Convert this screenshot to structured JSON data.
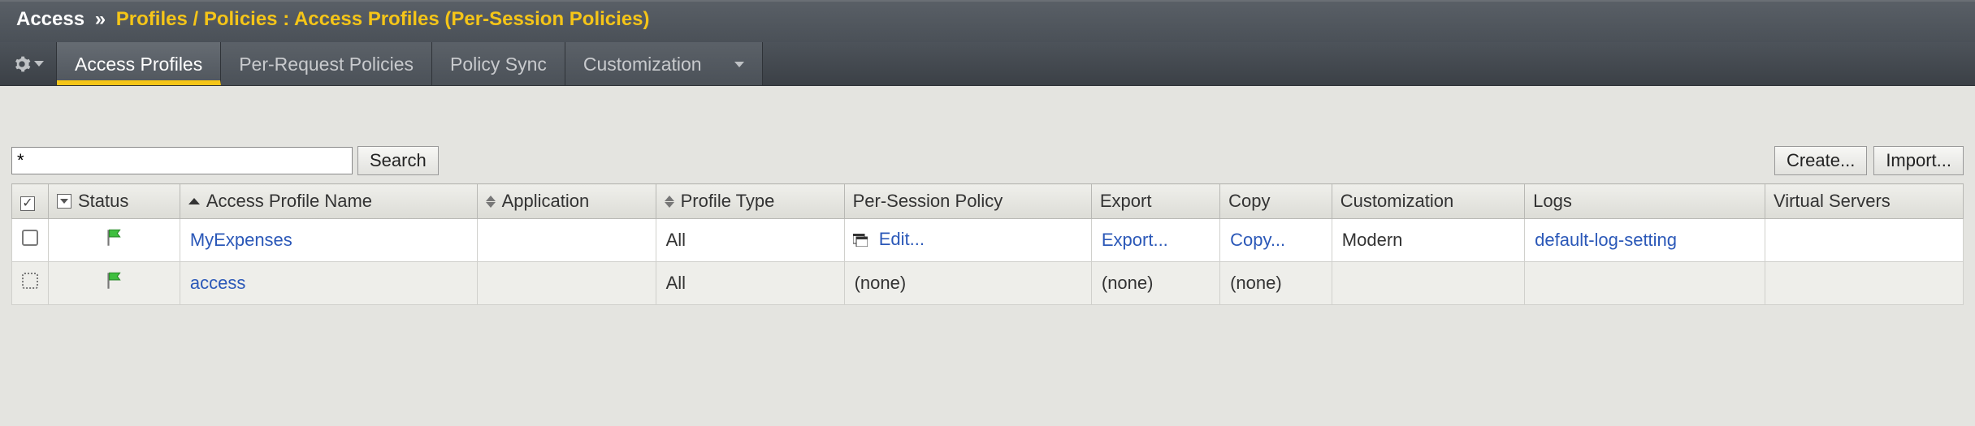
{
  "breadcrumb": {
    "section": "Access",
    "separator": "»",
    "path": "Profiles / Policies : Access Profiles (Per-Session Policies)"
  },
  "tabs": [
    {
      "label": "Access Profiles",
      "active": true
    },
    {
      "label": "Per-Request Policies",
      "active": false
    },
    {
      "label": "Policy Sync",
      "active": false
    },
    {
      "label": "Customization",
      "active": false,
      "dropdown": true
    }
  ],
  "search": {
    "value": "*",
    "button": "Search"
  },
  "toolbar": {
    "create": "Create...",
    "import": "Import..."
  },
  "columns": {
    "status": "Status",
    "name": "Access Profile Name",
    "application": "Application",
    "profile_type": "Profile Type",
    "per_session": "Per-Session Policy",
    "export": "Export",
    "copy": "Copy",
    "customization": "Customization",
    "logs": "Logs",
    "virtual_servers": "Virtual Servers"
  },
  "rows": [
    {
      "checkbox_style": "solid",
      "status_icon": "flag-green",
      "name": "MyExpenses",
      "application": "",
      "profile_type": "All",
      "per_session": "Edit...",
      "per_session_highlight": true,
      "export": "Export...",
      "copy": "Copy...",
      "customization": "Modern",
      "logs": "default-log-setting",
      "virtual_servers": ""
    },
    {
      "checkbox_style": "dotted",
      "status_icon": "flag-green",
      "name": "access",
      "application": "",
      "profile_type": "All",
      "per_session": "(none)",
      "per_session_highlight": false,
      "export": "(none)",
      "copy": "(none)",
      "customization": "",
      "logs": "",
      "virtual_servers": ""
    }
  ]
}
